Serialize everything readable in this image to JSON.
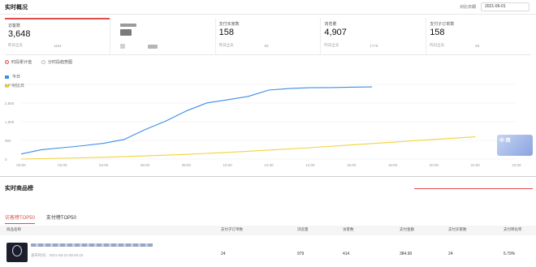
{
  "header": {
    "title": "实时概况",
    "date_label": "对比日期",
    "date_value": "2021-06-01"
  },
  "stats": [
    {
      "label": "访客数",
      "value": "3,648",
      "prev_label": "昨日全天",
      "prev_value": "1164"
    },
    {
      "label": "",
      "value": "",
      "prev_label": "",
      "prev_value": ""
    },
    {
      "label": "支付买家数",
      "value": "158",
      "prev_label": "昨日全天",
      "prev_value": "82"
    },
    {
      "label": "浏览量",
      "value": "4,907",
      "prev_label": "昨日全天",
      "prev_value": "1775"
    },
    {
      "label": "支付子订单数",
      "value": "158",
      "prev_label": "昨日全天",
      "prev_value": "83"
    }
  ],
  "modes": [
    {
      "label": "时段累计值",
      "selected": true
    },
    {
      "label": "分时段趋势图",
      "selected": false
    }
  ],
  "chart_data": {
    "type": "line",
    "x": [
      "00:00",
      "02:00",
      "04:00",
      "06:00",
      "08:00",
      "10:00",
      "12:00",
      "14:00",
      "16:00",
      "18:00",
      "20:00",
      "22:00",
      "23:00"
    ],
    "ylim": [
      0,
      3800
    ],
    "yticks": [
      0,
      950,
      1900,
      2850,
      3800
    ],
    "ytick_labels": [
      "0",
      "950",
      "1,900",
      "2,850",
      "3,800"
    ],
    "series": [
      {
        "name": "今日",
        "color": "#3a8ee6",
        "points": [
          [
            0,
            260
          ],
          [
            1,
            480
          ],
          [
            2,
            580
          ],
          [
            3,
            680
          ],
          [
            4,
            800
          ],
          [
            5,
            1000
          ],
          [
            6,
            1500
          ],
          [
            7,
            1930
          ],
          [
            8,
            2450
          ],
          [
            9,
            2860
          ],
          [
            10,
            3020
          ],
          [
            11,
            3190
          ],
          [
            12,
            3510
          ],
          [
            13,
            3590
          ],
          [
            14,
            3630
          ],
          [
            15,
            3640
          ],
          [
            16,
            3660
          ],
          [
            17,
            3670
          ]
        ]
      },
      {
        "name": "对比日",
        "color": "#f2d33a",
        "points": [
          [
            0,
            0
          ],
          [
            2,
            40
          ],
          [
            4,
            90
          ],
          [
            6,
            160
          ],
          [
            8,
            240
          ],
          [
            10,
            340
          ],
          [
            12,
            460
          ],
          [
            14,
            580
          ],
          [
            16,
            720
          ],
          [
            18,
            860
          ],
          [
            20,
            1000
          ],
          [
            22,
            1130
          ]
        ]
      }
    ]
  },
  "badge": {
    "text": "中 简"
  },
  "products": {
    "title": "实时商品榜",
    "tabs": [
      "访客榜TOP50",
      "支付榜TOP50"
    ],
    "columns": [
      "商品名称",
      "支付子订单数",
      "浏览量",
      "访客数",
      "支付金额",
      "支付买家数",
      "支付转化率"
    ],
    "rows": [
      {
        "publish_time": "发布时间：2021-05-23 09:49:23",
        "orders": "24",
        "views": "979",
        "visitors": "414",
        "amount": "384.90",
        "buyers": "24",
        "conversion": "5.79%"
      }
    ]
  }
}
